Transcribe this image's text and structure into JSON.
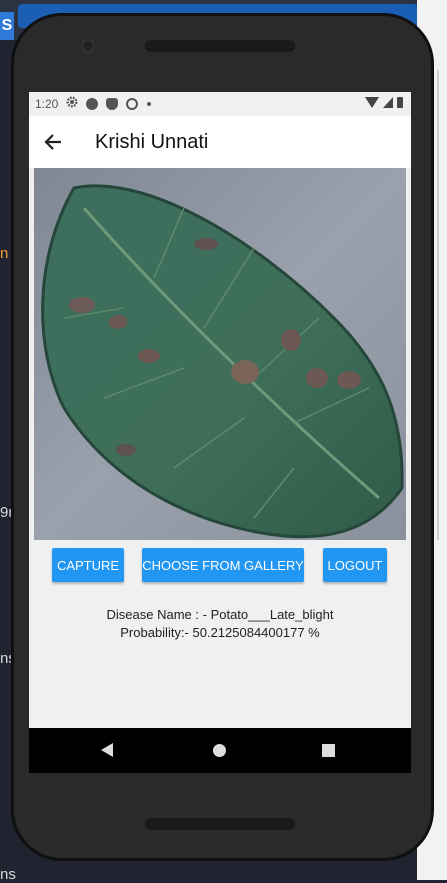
{
  "desktop": {
    "tab_letter": "S",
    "left_fragments": [
      "n",
      "9n",
      "ns",
      "ns"
    ]
  },
  "status_bar": {
    "time": "1:20",
    "icons": [
      "gear-icon",
      "a-icon",
      "shield-icon",
      "cast-icon",
      "dot-icon",
      "wifi-icon",
      "signal-icon",
      "battery-icon"
    ]
  },
  "app_bar": {
    "title": "Krishi Unnati",
    "back_icon": "arrow-left-icon"
  },
  "buttons": {
    "capture": "CAPTURE",
    "gallery": "CHOOSE FROM GALLERY",
    "logout": "LOGOUT"
  },
  "result": {
    "disease_line": "Disease Name : - Potato___Late_blight",
    "probability_line": "Probability:- 50.2125084400177 %"
  },
  "colors": {
    "accent": "#2196f3",
    "appbar": "#ffffff",
    "screen_bg": "#f0f0f0",
    "leaf": "#3b6a57"
  },
  "nav_bar": {
    "icons": [
      "nav-back-icon",
      "nav-home-icon",
      "nav-recents-icon"
    ]
  }
}
